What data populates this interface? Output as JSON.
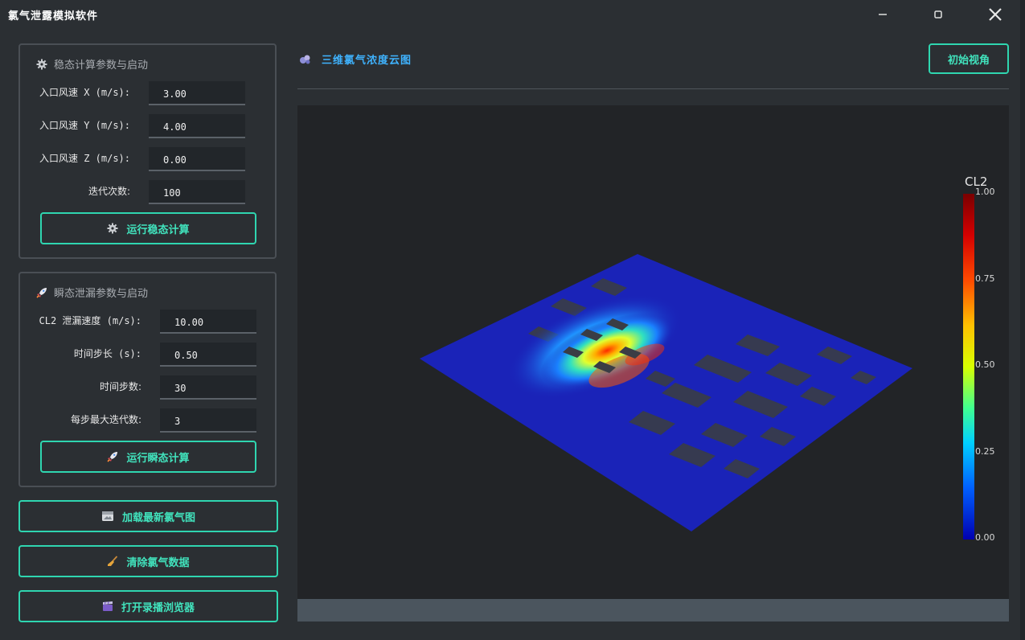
{
  "window": {
    "title": "氯气泄露模拟软件",
    "min_glyph": "−",
    "max_glyph": "▫",
    "close_glyph": "✕"
  },
  "steady": {
    "title": "稳态计算参数与启动",
    "icon": "gear-icon",
    "fields": [
      {
        "label": "入口风速 X (m/s):",
        "value": "3.00"
      },
      {
        "label": "入口风速 Y (m/s):",
        "value": "4.00"
      },
      {
        "label": "入口风速 Z (m/s):",
        "value": "0.00"
      },
      {
        "label": "迭代次数:",
        "value": "100"
      }
    ],
    "run_button": "运行稳态计算"
  },
  "transient": {
    "title": "瞬态泄漏参数与启动",
    "icon": "rocket-icon",
    "fields": [
      {
        "label": "CL2 泄漏速度 (m/s):",
        "value": "10.00"
      },
      {
        "label": "时间步长 (s):",
        "value": "0.50"
      },
      {
        "label": "时间步数:",
        "value": "30"
      },
      {
        "label": "每步最大迭代数:",
        "value": "3"
      }
    ],
    "run_button": "运行瞬态计算"
  },
  "actions": {
    "load_latest": "加载最新氯气图",
    "clear_data": "清除氯气数据",
    "open_recording": "打开录播浏览器"
  },
  "viewer": {
    "title": "三维氯气浓度云图",
    "reset_view": "初始视角",
    "colorbar": {
      "title": "CL2",
      "ticks": [
        "1.00",
        "0.75",
        "0.50",
        "0.25",
        "0.00"
      ]
    }
  },
  "colors": {
    "accent": "#2fd6b0",
    "title_blue": "#3fb3ff",
    "background": "#2b2f33",
    "plate": "#1a23b8"
  }
}
